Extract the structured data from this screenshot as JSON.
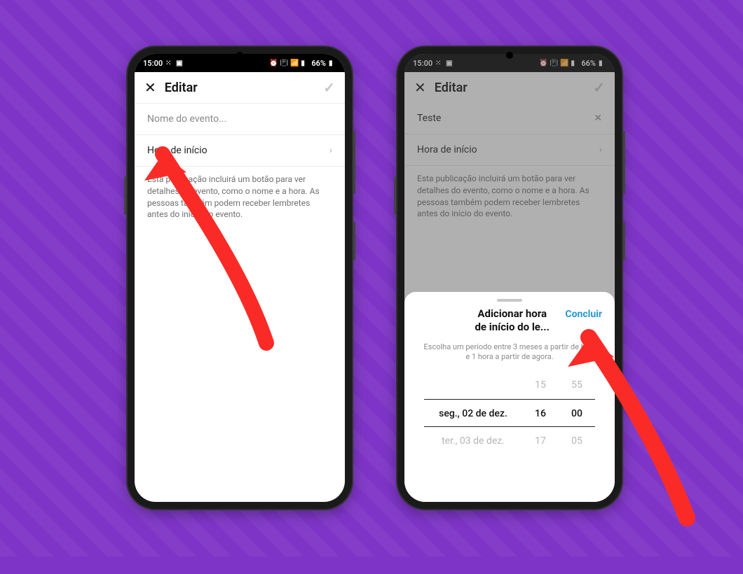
{
  "colors": {
    "accent": "#2597d6",
    "arrow": "#fa2b27",
    "bg": "#7e35c7"
  },
  "status": {
    "time": "15:00",
    "battery": "66%"
  },
  "left": {
    "header": {
      "title": "Editar"
    },
    "placeholder": "Nome do evento...",
    "start_row": "Hora de início",
    "description": "Esta publicação incluirá um botão para ver detalhes do evento, como o nome e a hora. As pessoas também podem receber lembretes antes do início do evento."
  },
  "right": {
    "header": {
      "title": "Editar"
    },
    "event_name": "Teste",
    "start_row": "Hora de início",
    "description": "Esta publicação incluirá um botão para ver detalhes do evento, como o nome e a hora. As pessoas também podem receber lembretes antes do início do evento.",
    "sheet": {
      "title_line1": "Adicionar hora",
      "title_line2": "de início do le...",
      "done": "Concluir",
      "subtitle": "Escolha um período entre 3 meses a partir de hoje e 1 hora a partir de agora.",
      "picker": {
        "date_prev": "",
        "date_sel": "seg., 02 de dez.",
        "date_next": "ter., 03 de dez.",
        "hour_prev": "15",
        "hour_sel": "16",
        "hour_next": "17",
        "min_prev": "55",
        "min_sel": "00",
        "min_next": "05"
      }
    }
  }
}
